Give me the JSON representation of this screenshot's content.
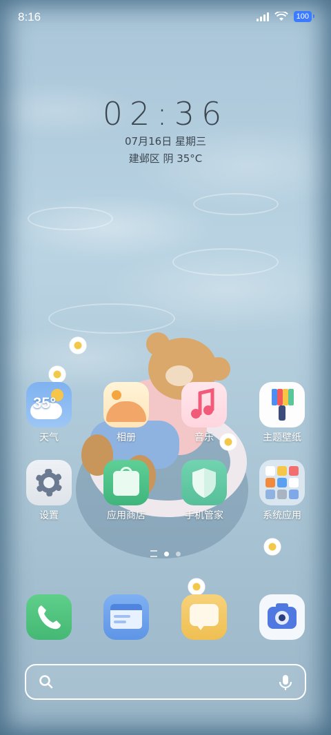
{
  "status_bar": {
    "time": "8:16",
    "battery": "100"
  },
  "lock_clock": {
    "time": "02:36",
    "date": "07月16日 星期三",
    "weather": "建邺区 阴 35°C"
  },
  "apps_row1": [
    {
      "label": "天气",
      "icon": "weather-icon",
      "badge_text": "35°"
    },
    {
      "label": "相册",
      "icon": "gallery-icon"
    },
    {
      "label": "音乐",
      "icon": "music-icon"
    },
    {
      "label": "主题壁纸",
      "icon": "theme-brush-icon"
    }
  ],
  "apps_row2": [
    {
      "label": "设置",
      "icon": "settings-gear-icon"
    },
    {
      "label": "应用商店",
      "icon": "app-store-bag-icon"
    },
    {
      "label": "手机管家",
      "icon": "security-shield-icon"
    },
    {
      "label": "系统应用",
      "icon": "system-apps-folder-icon"
    }
  ],
  "dock": [
    {
      "icon": "phone-icon"
    },
    {
      "icon": "browser-icon"
    },
    {
      "icon": "messages-icon"
    },
    {
      "icon": "camera-icon"
    }
  ],
  "pager": {
    "current_page": 2,
    "page_count": 2
  },
  "colors": {
    "accent_blue": "#3a7bff",
    "clock_text": "#3b4650"
  }
}
